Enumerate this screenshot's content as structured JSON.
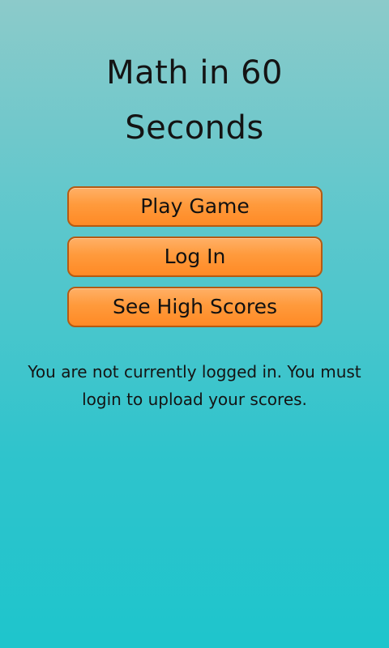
{
  "app": {
    "title": "Math in 60 Seconds"
  },
  "menu": {
    "play_label": "Play Game",
    "login_label": "Log In",
    "high_scores_label": "See High Scores"
  },
  "status": {
    "message": "You are not currently logged in. You must login to upload your scores."
  },
  "colors": {
    "background_top": "#8ccaca",
    "background_bottom": "#1ec5cc",
    "button_fill": "#ff9a3c",
    "button_border": "#b55a12",
    "text": "#141414"
  }
}
